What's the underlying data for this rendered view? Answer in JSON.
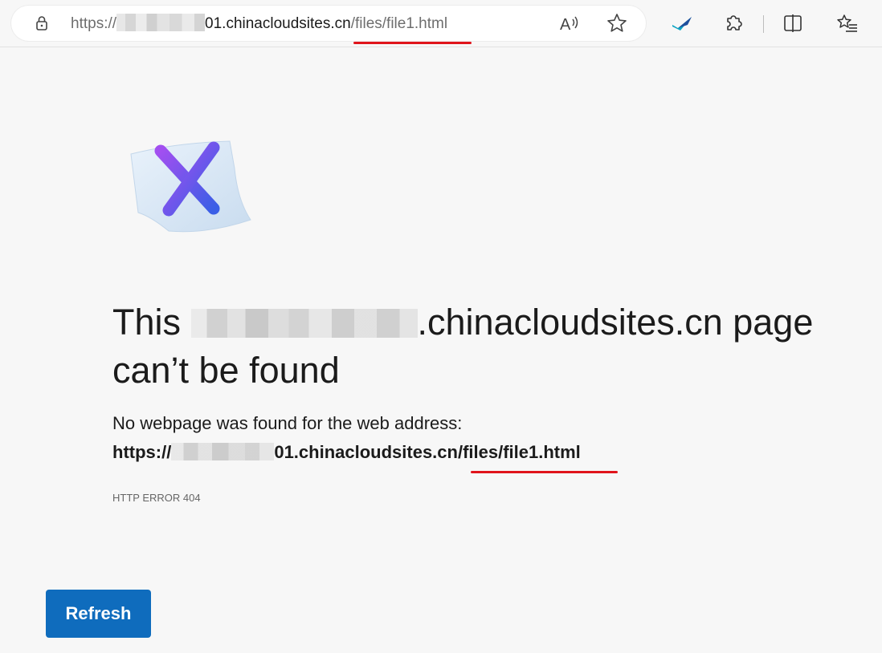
{
  "browser": {
    "url": {
      "scheme": "https://",
      "host": "01.chinacloudsites.cn",
      "path": "/files/file1.html"
    },
    "icons": [
      "lock-icon",
      "read-aloud-icon",
      "favorite-star-icon",
      "extension-pin-icon",
      "extensions-puzzle-icon",
      "split-screen-icon",
      "favorites-list-icon"
    ]
  },
  "error_page": {
    "title_prefix": "This",
    "title_suffix": ".chinacloudsites.cn page can’t be found",
    "description": "No webpage was found for the web address:",
    "url_prefix": "https://",
    "url_suffix": "01.chinacloudsites.cn/files/file1.html",
    "error_code": "HTTP ERROR 404",
    "refresh_label": "Refresh"
  },
  "colors": {
    "accent": "#0f6cbd",
    "annotation_red": "#e0141b",
    "illustration_x_start": "#a24ff0",
    "illustration_x_end": "#3a5ee6"
  }
}
